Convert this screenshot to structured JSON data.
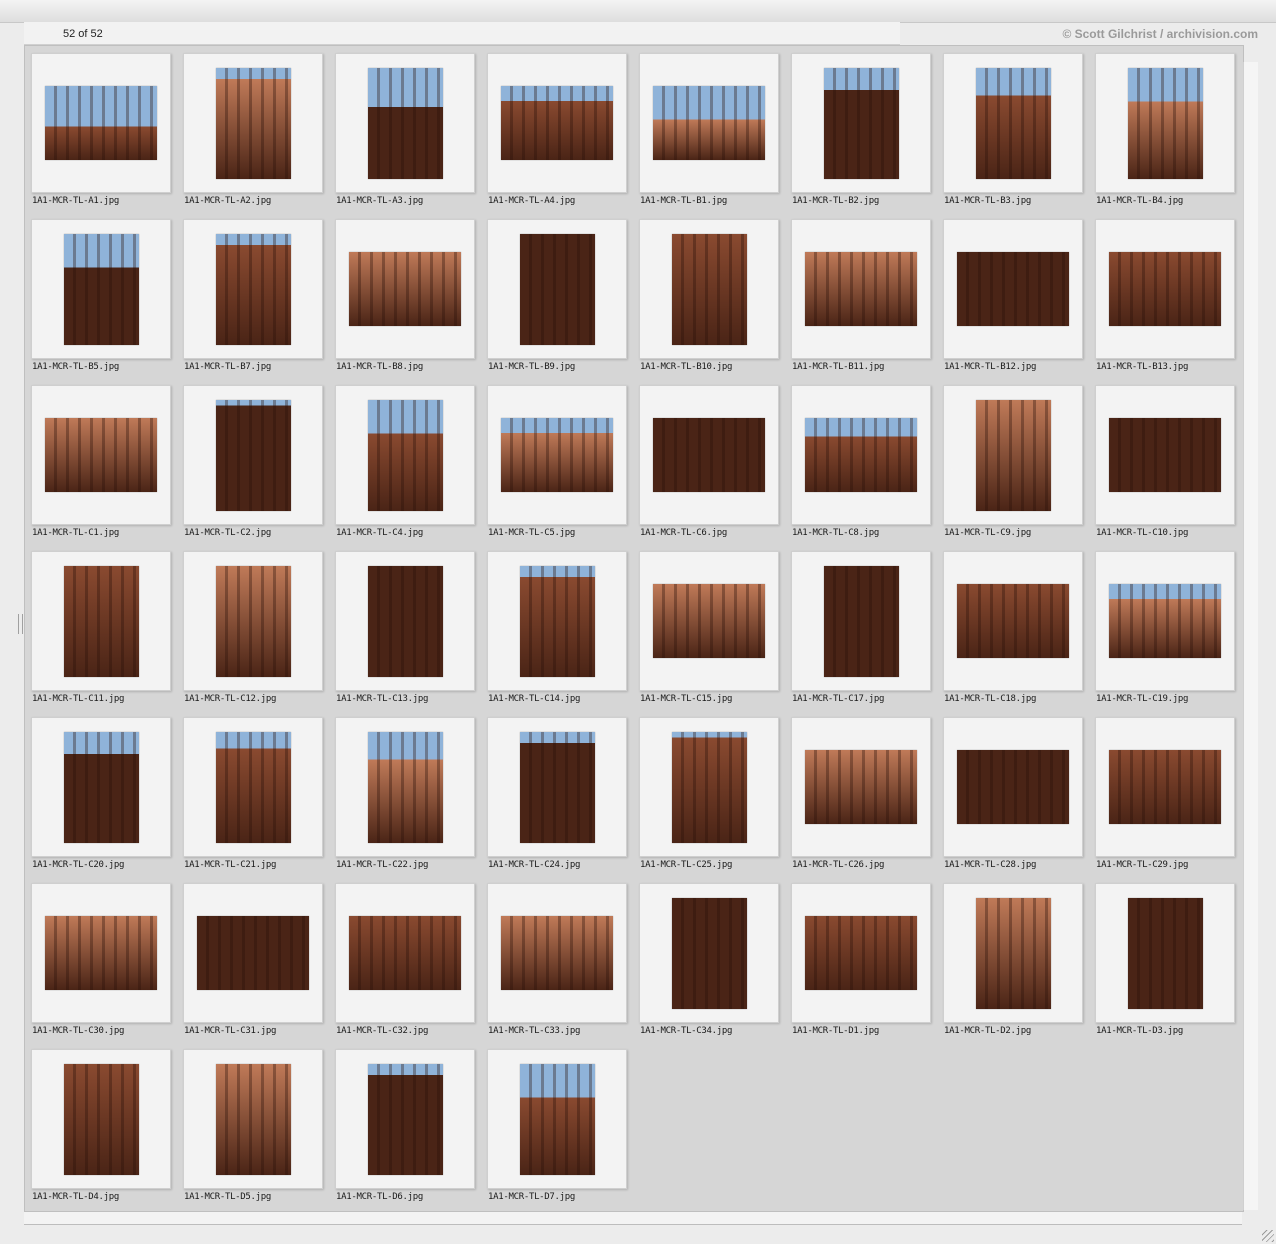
{
  "header": {
    "count_text": "52 of 52",
    "credit": "© Scott Gilchrist / archivision.com"
  },
  "colors": {
    "sky": "#8fb3d9",
    "stone": "#8a4a30",
    "stone_dark": "#4a2416",
    "stone_light": "#c07a58",
    "panel_bg": "#d6d6d6"
  },
  "thumbnails": [
    {
      "file": "1A1-MCR-TL-A1.jpg",
      "orient": "land",
      "sky": 0.55
    },
    {
      "file": "1A1-MCR-TL-A2.jpg",
      "orient": "port",
      "sky": 0.1
    },
    {
      "file": "1A1-MCR-TL-A3.jpg",
      "orient": "port",
      "sky": 0.35
    },
    {
      "file": "1A1-MCR-TL-A4.jpg",
      "orient": "land",
      "sky": 0.2
    },
    {
      "file": "1A1-MCR-TL-B1.jpg",
      "orient": "land",
      "sky": 0.45
    },
    {
      "file": "1A1-MCR-TL-B2.jpg",
      "orient": "port",
      "sky": 0.2
    },
    {
      "file": "1A1-MCR-TL-B3.jpg",
      "orient": "port",
      "sky": 0.25
    },
    {
      "file": "1A1-MCR-TL-B4.jpg",
      "orient": "port",
      "sky": 0.3
    },
    {
      "file": "1A1-MCR-TL-B5.jpg",
      "orient": "port",
      "sky": 0.3
    },
    {
      "file": "1A1-MCR-TL-B7.jpg",
      "orient": "port",
      "sky": 0.1
    },
    {
      "file": "1A1-MCR-TL-B8.jpg",
      "orient": "land",
      "sky": 0.0
    },
    {
      "file": "1A1-MCR-TL-B9.jpg",
      "orient": "port",
      "sky": 0.0
    },
    {
      "file": "1A1-MCR-TL-B10.jpg",
      "orient": "port",
      "sky": 0.0
    },
    {
      "file": "1A1-MCR-TL-B11.jpg",
      "orient": "land",
      "sky": 0.0
    },
    {
      "file": "1A1-MCR-TL-B12.jpg",
      "orient": "land",
      "sky": 0.0
    },
    {
      "file": "1A1-MCR-TL-B13.jpg",
      "orient": "land",
      "sky": 0.0
    },
    {
      "file": "1A1-MCR-TL-C1.jpg",
      "orient": "land",
      "sky": 0.0
    },
    {
      "file": "1A1-MCR-TL-C2.jpg",
      "orient": "port",
      "sky": 0.05
    },
    {
      "file": "1A1-MCR-TL-C4.jpg",
      "orient": "port",
      "sky": 0.3
    },
    {
      "file": "1A1-MCR-TL-C5.jpg",
      "orient": "land",
      "sky": 0.2
    },
    {
      "file": "1A1-MCR-TL-C6.jpg",
      "orient": "land",
      "sky": 0.0
    },
    {
      "file": "1A1-MCR-TL-C8.jpg",
      "orient": "land",
      "sky": 0.25
    },
    {
      "file": "1A1-MCR-TL-C9.jpg",
      "orient": "port",
      "sky": 0.0
    },
    {
      "file": "1A1-MCR-TL-C10.jpg",
      "orient": "land",
      "sky": 0.0
    },
    {
      "file": "1A1-MCR-TL-C11.jpg",
      "orient": "port",
      "sky": 0.0
    },
    {
      "file": "1A1-MCR-TL-C12.jpg",
      "orient": "port",
      "sky": 0.0
    },
    {
      "file": "1A1-MCR-TL-C13.jpg",
      "orient": "port",
      "sky": 0.0
    },
    {
      "file": "1A1-MCR-TL-C14.jpg",
      "orient": "port",
      "sky": 0.1
    },
    {
      "file": "1A1-MCR-TL-C15.jpg",
      "orient": "land",
      "sky": 0.0
    },
    {
      "file": "1A1-MCR-TL-C17.jpg",
      "orient": "port",
      "sky": 0.0
    },
    {
      "file": "1A1-MCR-TL-C18.jpg",
      "orient": "land",
      "sky": 0.0
    },
    {
      "file": "1A1-MCR-TL-C19.jpg",
      "orient": "land",
      "sky": 0.2
    },
    {
      "file": "1A1-MCR-TL-C20.jpg",
      "orient": "port",
      "sky": 0.2
    },
    {
      "file": "1A1-MCR-TL-C21.jpg",
      "orient": "port",
      "sky": 0.15
    },
    {
      "file": "1A1-MCR-TL-C22.jpg",
      "orient": "port",
      "sky": 0.25
    },
    {
      "file": "1A1-MCR-TL-C24.jpg",
      "orient": "port",
      "sky": 0.1
    },
    {
      "file": "1A1-MCR-TL-C25.jpg",
      "orient": "port",
      "sky": 0.05
    },
    {
      "file": "1A1-MCR-TL-C26.jpg",
      "orient": "land",
      "sky": 0.0
    },
    {
      "file": "1A1-MCR-TL-C28.jpg",
      "orient": "land",
      "sky": 0.0
    },
    {
      "file": "1A1-MCR-TL-C29.jpg",
      "orient": "land",
      "sky": 0.0
    },
    {
      "file": "1A1-MCR-TL-C30.jpg",
      "orient": "land",
      "sky": 0.0
    },
    {
      "file": "1A1-MCR-TL-C31.jpg",
      "orient": "land",
      "sky": 0.0
    },
    {
      "file": "1A1-MCR-TL-C32.jpg",
      "orient": "land",
      "sky": 0.0
    },
    {
      "file": "1A1-MCR-TL-C33.jpg",
      "orient": "land",
      "sky": 0.0
    },
    {
      "file": "1A1-MCR-TL-C34.jpg",
      "orient": "port",
      "sky": 0.0
    },
    {
      "file": "1A1-MCR-TL-D1.jpg",
      "orient": "land",
      "sky": 0.0
    },
    {
      "file": "1A1-MCR-TL-D2.jpg",
      "orient": "port",
      "sky": 0.0
    },
    {
      "file": "1A1-MCR-TL-D3.jpg",
      "orient": "port",
      "sky": 0.0
    },
    {
      "file": "1A1-MCR-TL-D4.jpg",
      "orient": "port",
      "sky": 0.0
    },
    {
      "file": "1A1-MCR-TL-D5.jpg",
      "orient": "port",
      "sky": 0.0
    },
    {
      "file": "1A1-MCR-TL-D6.jpg",
      "orient": "port",
      "sky": 0.1
    },
    {
      "file": "1A1-MCR-TL-D7.jpg",
      "orient": "port",
      "sky": 0.3
    }
  ]
}
